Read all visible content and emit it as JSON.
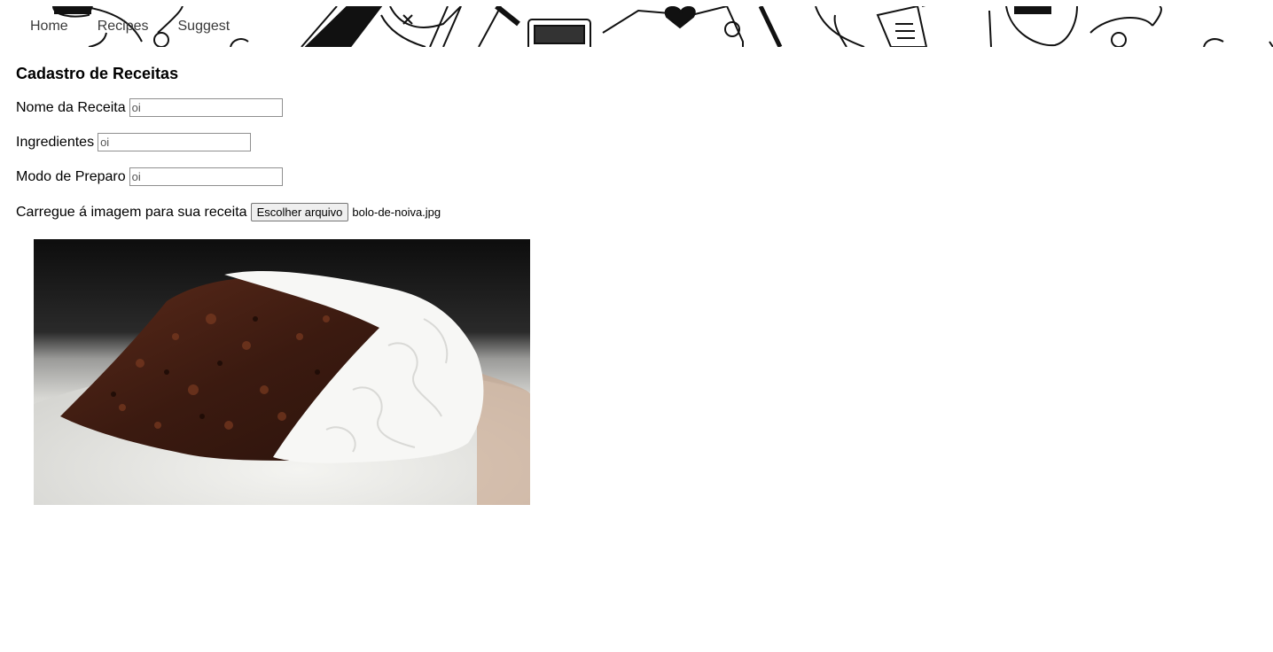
{
  "nav": {
    "items": [
      "Home",
      "Recipes",
      "Suggest"
    ]
  },
  "form": {
    "title": "Cadastro de Receitas",
    "recipe_name": {
      "label": "Nome da Receita",
      "value": "oi"
    },
    "ingredients": {
      "label": "Ingredientes",
      "value": "oi"
    },
    "preparation": {
      "label": "Modo de Preparo",
      "value": "oi"
    },
    "image_upload": {
      "label": "Carregue á imagem para sua receita",
      "button_label": "Escolher arquivo",
      "file_name": "bolo-de-noiva.jpg"
    }
  },
  "colors": {
    "nav_text": "#3a3a3a",
    "background": "#ffffff"
  }
}
